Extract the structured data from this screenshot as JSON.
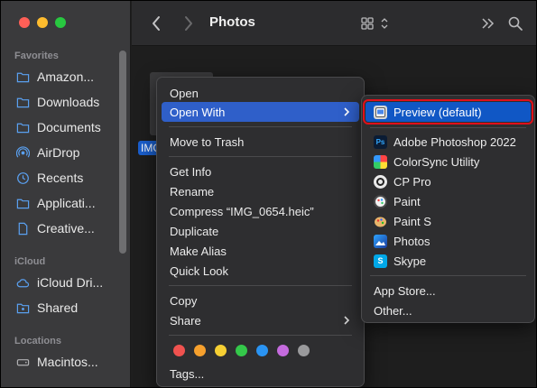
{
  "window": {
    "title": "Photos"
  },
  "sidebar": {
    "sections": [
      {
        "title": "Favorites"
      },
      {
        "title": "iCloud"
      },
      {
        "title": "Locations"
      }
    ],
    "favorites": [
      {
        "label": "Amazon...",
        "icon": "folder-icon"
      },
      {
        "label": "Downloads",
        "icon": "folder-icon"
      },
      {
        "label": "Documents",
        "icon": "folder-icon"
      },
      {
        "label": "AirDrop",
        "icon": "airdrop-icon"
      },
      {
        "label": "Recents",
        "icon": "clock-icon"
      },
      {
        "label": "Applicati...",
        "icon": "folder-icon"
      },
      {
        "label": "Creative...",
        "icon": "document-icon"
      }
    ],
    "icloud": [
      {
        "label": "iCloud Dri...",
        "icon": "cloud-icon"
      },
      {
        "label": "Shared",
        "icon": "shared-folder-icon"
      }
    ],
    "locations": [
      {
        "label": "Macintos...",
        "icon": "disk-icon"
      }
    ]
  },
  "content": {
    "file_label": "IMG"
  },
  "context_menu": {
    "items": [
      {
        "label": "Open"
      },
      {
        "label": "Open With",
        "submenu": true,
        "selected": true
      },
      {
        "label": "Move to Trash"
      },
      {
        "label": "Get Info"
      },
      {
        "label": "Rename"
      },
      {
        "label": "Compress “IMG_0654.heic”"
      },
      {
        "label": "Duplicate"
      },
      {
        "label": "Make Alias"
      },
      {
        "label": "Quick Look"
      },
      {
        "label": "Copy"
      },
      {
        "label": "Share",
        "submenu": true
      },
      {
        "label": "Tags..."
      }
    ],
    "tag_colors": [
      "#f0524f",
      "#f6a02d",
      "#f6cf33",
      "#34c84a",
      "#2a94f3",
      "#c56bde",
      "#9a9a9c"
    ]
  },
  "open_with_menu": {
    "items": [
      {
        "label": "Preview (default)",
        "icon": "preview-icon",
        "highlighted": true
      },
      {
        "label": "Adobe Photoshop 2022",
        "icon": "photoshop-icon",
        "icon_text": "Ps"
      },
      {
        "label": "ColorSync Utility",
        "icon": "colorsync-icon"
      },
      {
        "label": "CP Pro",
        "icon": "cp-pro-icon"
      },
      {
        "label": "Paint",
        "icon": "paint-icon"
      },
      {
        "label": "Paint S",
        "icon": "paint-s-icon"
      },
      {
        "label": "Photos",
        "icon": "photos-icon"
      },
      {
        "label": "Skype",
        "icon": "skype-icon",
        "icon_text": "S"
      },
      {
        "label": "App Store..."
      },
      {
        "label": "Other..."
      }
    ]
  }
}
